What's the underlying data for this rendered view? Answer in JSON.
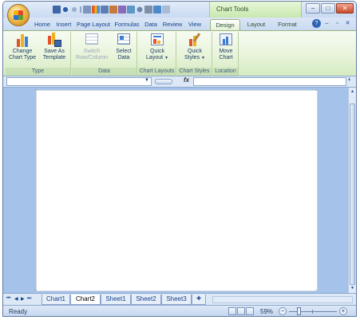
{
  "titlebar": {
    "context_tab_label": "Chart Tools",
    "window_buttons": {
      "minimize": "–",
      "maximize": "□",
      "close": "✕"
    }
  },
  "qat": {
    "icons": [
      "save-icon",
      "undo-icon",
      "redo-icon",
      "print-preview-icon",
      "chart-icon",
      "table-icon",
      "edit-icon",
      "paste-icon",
      "shapes-icon",
      "circle-icon",
      "tools-icon",
      "arrange-icon"
    ]
  },
  "tabs": [
    {
      "label": "Home"
    },
    {
      "label": "Insert"
    },
    {
      "label": "Page Layout"
    },
    {
      "label": "Formulas"
    },
    {
      "label": "Data"
    },
    {
      "label": "Review"
    },
    {
      "label": "View"
    },
    {
      "label": "Design"
    },
    {
      "label": "Layout"
    },
    {
      "label": "Format"
    }
  ],
  "tab_icons": {
    "help": "?",
    "minimize": "–",
    "restore": "▫",
    "close": "✕"
  },
  "ribbon": {
    "groups": [
      {
        "label": "Type",
        "buttons": [
          {
            "line1": "Change",
            "line2": "Chart Type"
          },
          {
            "line1": "Save As",
            "line2": "Template"
          }
        ]
      },
      {
        "label": "Data",
        "buttons": [
          {
            "line1": "Switch",
            "line2": "Row/Column"
          },
          {
            "line1": "Select",
            "line2": "Data"
          }
        ]
      },
      {
        "label": "Chart Layouts",
        "buttons": [
          {
            "line1": "Quick",
            "line2": "Layout"
          }
        ]
      },
      {
        "label": "Chart Styles",
        "buttons": [
          {
            "line1": "Quick",
            "line2": "Styles"
          }
        ]
      },
      {
        "label": "Location",
        "buttons": [
          {
            "line1": "Move",
            "line2": "Chart"
          }
        ]
      }
    ]
  },
  "formula_bar": {
    "name_box_value": "",
    "fx_label": "fx",
    "formula_value": ""
  },
  "sheets": [
    {
      "label": "Chart1"
    },
    {
      "label": "Chart2"
    },
    {
      "label": "Sheet1"
    },
    {
      "label": "Sheet2"
    },
    {
      "label": "Sheet3"
    }
  ],
  "status": {
    "ready": "Ready",
    "zoom": "59%",
    "zoom_fraction": 0.59
  },
  "colors": {
    "ribbon_accent": "#e6f3d8",
    "frame_blue": "#c4d7ef",
    "workspace_blue": "#a4c2ea"
  }
}
